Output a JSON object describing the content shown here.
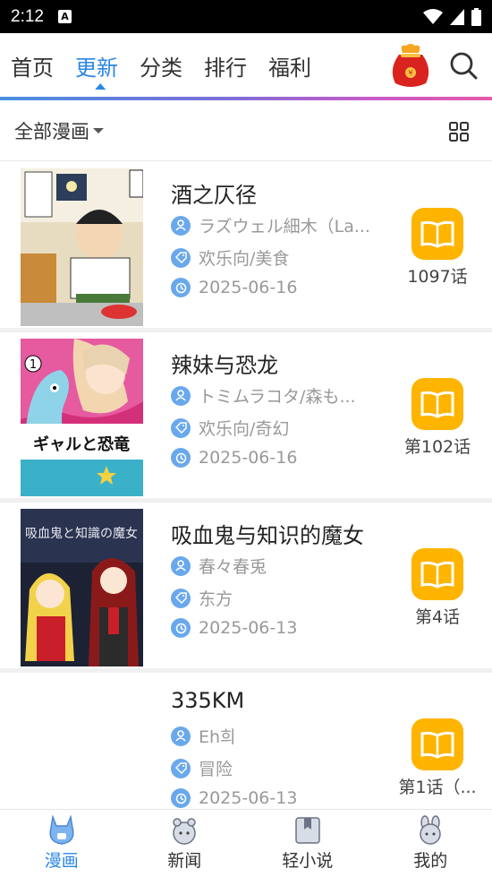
{
  "status": {
    "time": "2:12",
    "a_icon": "A"
  },
  "nav": {
    "tabs": [
      {
        "label": "首页",
        "active": false
      },
      {
        "label": "更新",
        "active": true
      },
      {
        "label": "分类",
        "active": false
      },
      {
        "label": "排行",
        "active": false
      },
      {
        "label": "福利",
        "active": false
      }
    ],
    "gift_icon": "red-envelope-gift-icon",
    "search_icon": "search-icon"
  },
  "filter": {
    "label": "全部漫画",
    "grid_icon": "grid-view-icon"
  },
  "items": [
    {
      "title": "酒之仄径",
      "author": "ラズウェル細木（La...",
      "tags": "欢乐向/美食",
      "date": "2025-06-16",
      "chapter": "1097话"
    },
    {
      "title": "辣妹与恐龙",
      "author": "トミムラコタ/森も...",
      "tags": "欢乐向/奇幻",
      "date": "2025-06-16",
      "chapter": "第102话"
    },
    {
      "title": "吸血鬼与知识的魔女",
      "author": "春々春兎",
      "tags": "东方",
      "date": "2025-06-13",
      "chapter": "第4话"
    },
    {
      "title": "335KM",
      "author": "Eh희",
      "tags": "冒险",
      "date": "2025-06-13",
      "chapter": "第1话（..."
    }
  ],
  "cover_texts": {
    "c2": "ギャルと恐竜",
    "c3": "吸血鬼と知識の魔女"
  },
  "bottom": {
    "tabs": [
      {
        "label": "漫画",
        "active": true
      },
      {
        "label": "新闻",
        "active": false
      },
      {
        "label": "轻小说",
        "active": false
      },
      {
        "label": "我的",
        "active": false
      }
    ]
  },
  "colors": {
    "accent": "#2b87e6",
    "book": "#ffb400",
    "meta_icon": "#6aa8ec"
  }
}
